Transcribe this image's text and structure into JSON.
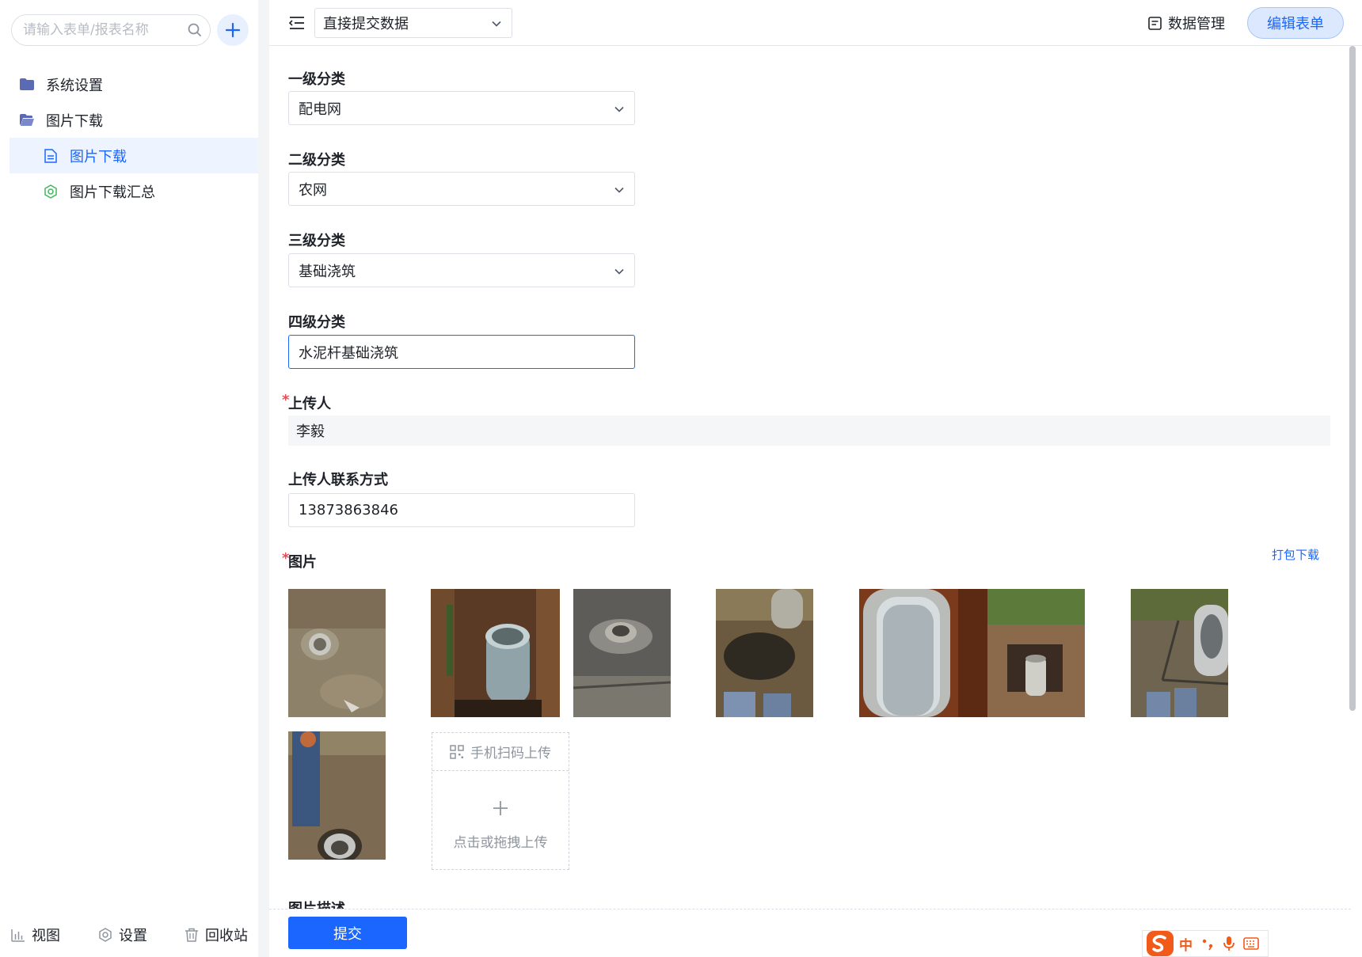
{
  "sidebar": {
    "search_placeholder": "请输入表单/报表名称",
    "tree": [
      {
        "label": "系统设置",
        "icon": "folder-icon"
      },
      {
        "label": "图片下载",
        "icon": "folder-open-icon"
      },
      {
        "label": "图片下载",
        "icon": "form-doc-icon",
        "active": true
      },
      {
        "label": "图片下载汇总",
        "icon": "report-icon"
      }
    ],
    "footer": [
      {
        "label": "视图",
        "icon": "bar-chart-icon"
      },
      {
        "label": "设置",
        "icon": "gear-icon"
      },
      {
        "label": "回收站",
        "icon": "trash-icon"
      }
    ]
  },
  "topbar": {
    "mode": "直接提交数据",
    "data_mgmt": "数据管理",
    "edit_button": "编辑表单"
  },
  "form": {
    "fields": [
      {
        "label": "一级分类",
        "value": "配电网",
        "type": "select"
      },
      {
        "label": "二级分类",
        "value": "农网",
        "type": "select"
      },
      {
        "label": "三级分类",
        "value": "基础浇筑",
        "type": "select"
      },
      {
        "label": "四级分类",
        "value": "水泥杆基础浇筑",
        "type": "text"
      }
    ],
    "uploader": {
      "label": "上传人",
      "value": "李毅",
      "required": true
    },
    "contact": {
      "label": "上传人联系方式",
      "value": "13873863846"
    },
    "images": {
      "label": "图片",
      "required": true,
      "pack_download": "打包下载",
      "count": 8,
      "qr_upload": "手机扫码上传",
      "drag_upload": "点击或拖拽上传"
    },
    "next_label": "图片描述",
    "submit": "提交"
  },
  "ime": {
    "label": "中"
  },
  "colors": {
    "accent": "#1a66ff",
    "required": "#e34d59",
    "folder": "#5b6ab5",
    "report": "#3bb85a"
  }
}
